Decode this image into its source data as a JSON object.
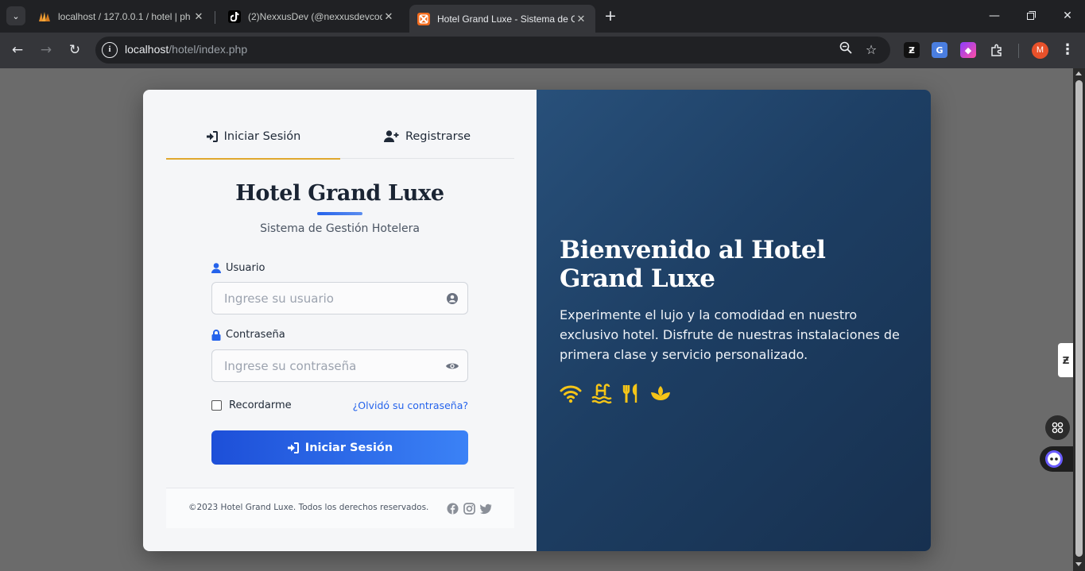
{
  "browser": {
    "tabs": [
      {
        "title": "localhost / 127.0.0.1 / hotel | ph",
        "favicon": "phpmyadmin-icon"
      },
      {
        "title": "(2)NexxusDev (@nexxusdevcode",
        "favicon": "tiktok-icon"
      },
      {
        "title": "Hotel Grand Luxe - Sistema de G",
        "favicon": "xampp-icon",
        "active": true
      }
    ],
    "url_host": "localhost",
    "url_path": "/hotel/index.php",
    "profile_initial": "M"
  },
  "colors": {
    "accent": "#e0a82e",
    "primary": "#2563eb",
    "panel_dark": "#1d3e63",
    "amenity_gold": "#f5c518"
  },
  "form": {
    "tab_login": "Iniciar Sesión",
    "tab_register": "Registrarse",
    "hotel_name": "Hotel Grand Luxe",
    "subtitle": "Sistema de Gestión Hotelera",
    "user_label": "Usuario",
    "user_placeholder": "Ingrese su usuario",
    "password_label": "Contraseña",
    "password_placeholder": "Ingrese su contraseña",
    "remember": "Recordarme",
    "forgot": "¿Olvidó su contraseña?",
    "submit": "Iniciar Sesión"
  },
  "footer": {
    "copyright": "©2023 Hotel Grand Luxe. Todos los derechos reservados.",
    "social": [
      "facebook-icon",
      "instagram-icon",
      "twitter-icon"
    ]
  },
  "promo": {
    "title": "Bienvenido al Hotel Grand Luxe",
    "text": "Experimente el lujo y la comodidad en nuestro exclusivo hotel. Disfrute de nuestras instalaciones de primera clase y servicio personalizado.",
    "amenities": [
      "wifi-icon",
      "pool-icon",
      "restaurant-icon",
      "spa-icon"
    ]
  }
}
